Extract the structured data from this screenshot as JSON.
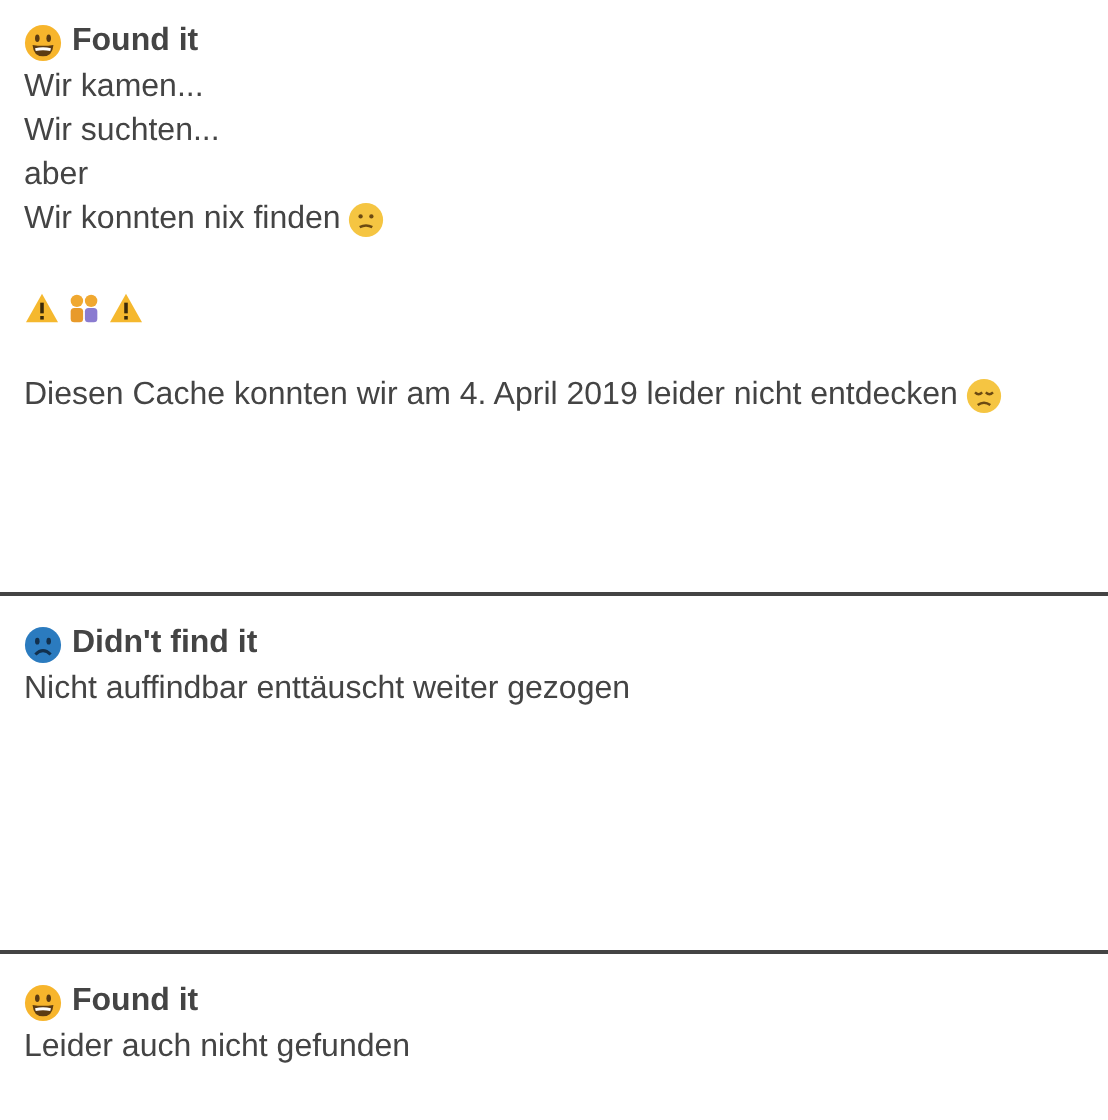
{
  "logs": [
    {
      "kind": "found",
      "label": "Found it",
      "lines": [
        {
          "kind": "text",
          "text": "Wir kamen..."
        },
        {
          "kind": "text",
          "text": "Wir suchten..."
        },
        {
          "kind": "text",
          "text": "aber"
        },
        {
          "kind": "text-confused",
          "text": "Wir konnten nix finden"
        },
        {
          "kind": "blank"
        },
        {
          "kind": "warning-row"
        },
        {
          "kind": "blank"
        },
        {
          "kind": "text-disappointed",
          "text": "Diesen Cache konnten wir am 4. April 2019 leider nicht entdecken"
        }
      ]
    },
    {
      "kind": "dnf",
      "label": "Didn't find it",
      "lines": [
        {
          "kind": "text",
          "text": "Nicht auffindbar enttäuscht weiter gezogen"
        }
      ]
    },
    {
      "kind": "found",
      "label": "Found it",
      "lines": [
        {
          "kind": "text",
          "text": "Leider auch nicht gefunden"
        }
      ]
    }
  ]
}
